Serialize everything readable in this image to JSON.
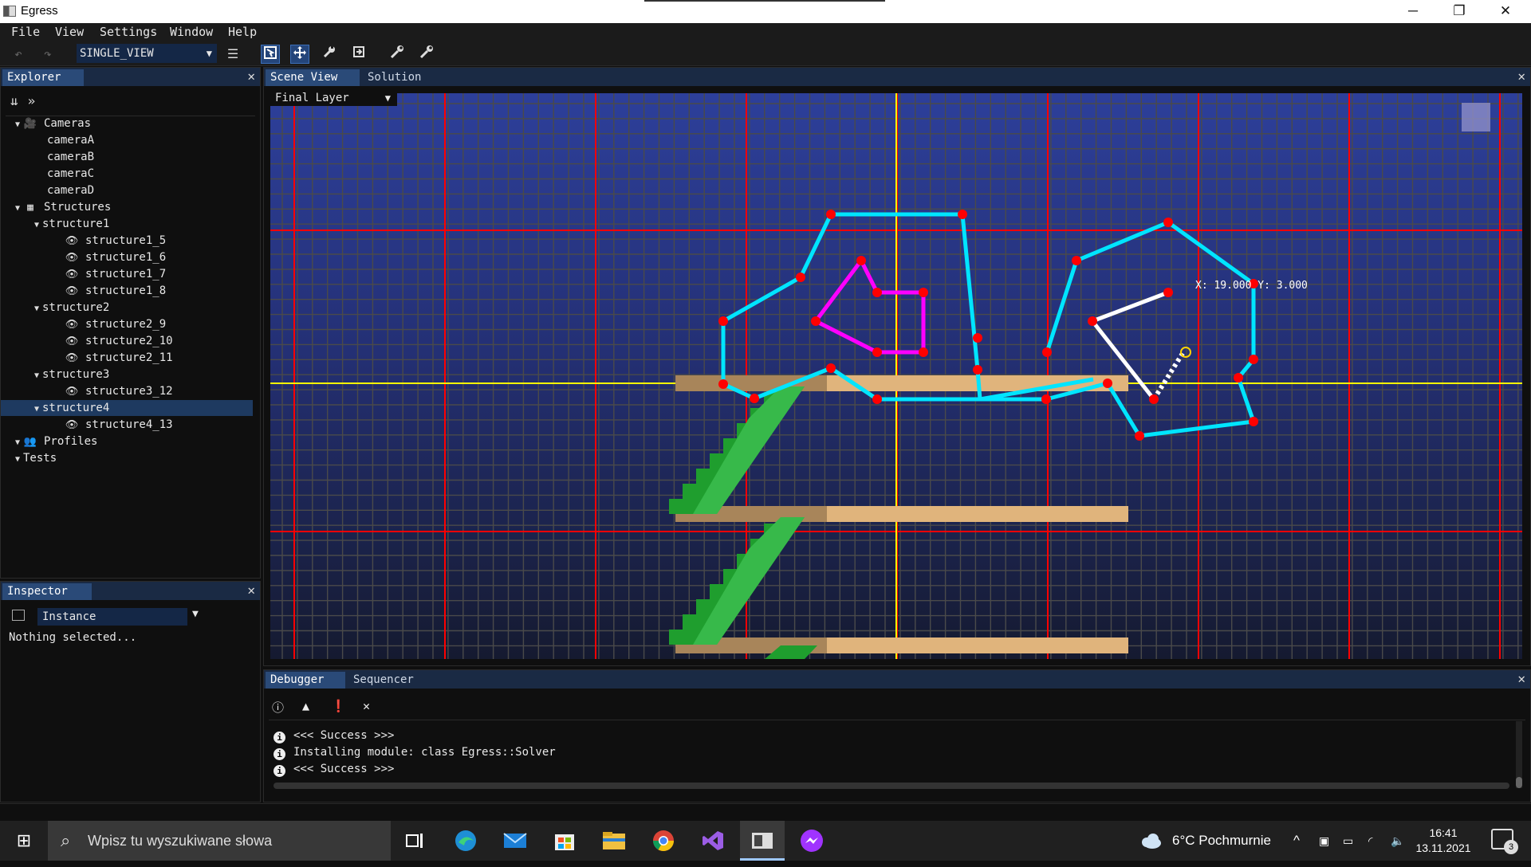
{
  "window": {
    "title": "Egress",
    "minimize": "─",
    "maximize": "❐",
    "close": "✕"
  },
  "menu": [
    "File",
    "View",
    "Settings",
    "Window",
    "Help"
  ],
  "toolbar": {
    "undo": "↶",
    "redo": "↷",
    "view_mode": "SINGLE_VIEW",
    "dropdown": "▼",
    "layout": "☰"
  },
  "explorer": {
    "tab": "Explorer",
    "close": "✕",
    "collapse": "⇊",
    "expand": "»",
    "tree": [
      {
        "label": "Cameras",
        "twisty": "▼",
        "icon": "🎥"
      },
      {
        "label": "cameraA"
      },
      {
        "label": "cameraB"
      },
      {
        "label": "cameraC"
      },
      {
        "label": "cameraD"
      },
      {
        "label": "Structures",
        "twisty": "▼",
        "icon": "▦"
      },
      {
        "label": "structure1",
        "twisty": "▼"
      },
      {
        "label": "structure1_5",
        "icon": "👁"
      },
      {
        "label": "structure1_6",
        "icon": "👁"
      },
      {
        "label": "structure1_7",
        "icon": "👁"
      },
      {
        "label": "structure1_8",
        "icon": "👁"
      },
      {
        "label": "structure2",
        "twisty": "▼"
      },
      {
        "label": "structure2_9",
        "icon": "👁"
      },
      {
        "label": "structure2_10",
        "icon": "👁"
      },
      {
        "label": "structure2_11",
        "icon": "👁"
      },
      {
        "label": "structure3",
        "twisty": "▼"
      },
      {
        "label": "structure3_12",
        "icon": "👁"
      },
      {
        "label": "structure4",
        "twisty": "▼",
        "selected": true
      },
      {
        "label": "structure4_13",
        "icon": "👁"
      },
      {
        "label": "Profiles",
        "twisty": "▼",
        "icon": "👥"
      },
      {
        "label": "Tests",
        "twisty": "▼"
      }
    ]
  },
  "inspector": {
    "tab": "Inspector",
    "close": "✕",
    "mode": "Instance",
    "dropdown": "▼",
    "message": "Nothing selected..."
  },
  "scene": {
    "tabs": [
      "Scene View",
      "Solution"
    ],
    "close": "✕",
    "layer": "Final Layer",
    "layer_dropdown": "▼",
    "cursor_readout": "X: 19.000  Y: 3.000",
    "colors": {
      "background": "#2b3a8c",
      "grid": "#4a4a4a",
      "axis": "#ffff00",
      "major": "#ff0000",
      "polygon_a": "#00e5ff",
      "polygon_b": "#ff00ff",
      "points": "#ff0000",
      "platform": "#e0b47c",
      "stairs": "#1f9e2e"
    }
  },
  "debugger": {
    "tabs": [
      "Debugger",
      "Sequencer"
    ],
    "close": "✕",
    "icons": {
      "info": "ⓘ",
      "warning": "▲",
      "error": "❗",
      "clear": "✕"
    },
    "log": [
      {
        "icon": "i",
        "text": "<<< Success >>>"
      },
      {
        "icon": "i",
        "text": "Installing module: class Egress::Solver"
      },
      {
        "icon": "i",
        "text": "<<< Success >>>"
      }
    ]
  },
  "taskbar": {
    "start": "⊞",
    "search_placeholder": "Wpisz tu wyszukiwane słowa",
    "search_icon": "⌕",
    "apps": [
      "task-view",
      "edge",
      "mail",
      "store",
      "explorer",
      "chrome",
      "visual-studio",
      "egress",
      "messenger"
    ],
    "weather": "6°C  Pochmurnie",
    "time": "16:41",
    "date": "13.11.2021",
    "notifications": "3"
  }
}
